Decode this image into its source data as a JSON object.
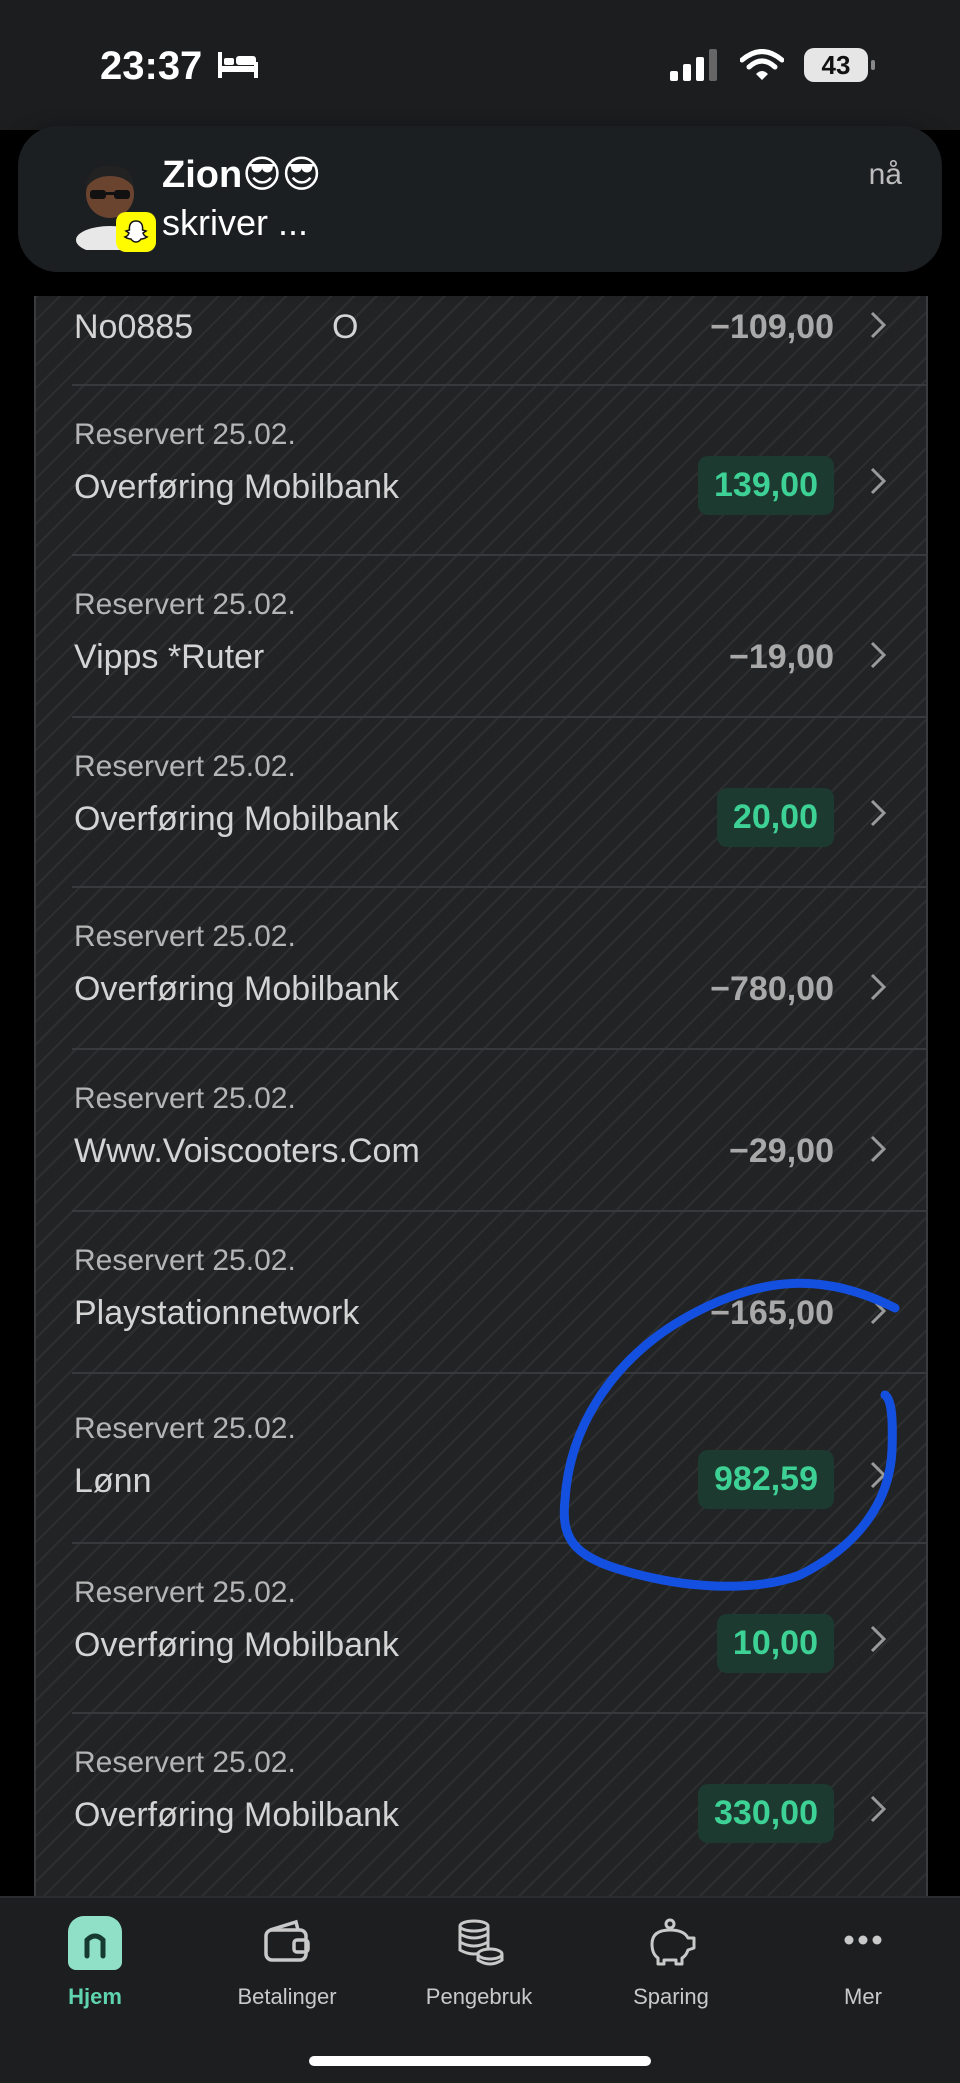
{
  "status_bar": {
    "time": "23:37",
    "battery": "43"
  },
  "notification": {
    "title": "Zion😎😎",
    "body": "skriver ...",
    "time": "nå"
  },
  "transactions": [
    {
      "date": "",
      "description": "No0885",
      "extra": "O",
      "amount": "−109,00",
      "positive": false
    },
    {
      "date": "Reservert 25.02.",
      "description": "Overføring Mobilbank",
      "amount": "139,00",
      "positive": true
    },
    {
      "date": "Reservert 25.02.",
      "description": "Vipps *Ruter",
      "amount": "−19,00",
      "positive": false
    },
    {
      "date": "Reservert 25.02.",
      "description": "Overføring Mobilbank",
      "amount": "20,00",
      "positive": true
    },
    {
      "date": "Reservert 25.02.",
      "description": "Overføring Mobilbank",
      "amount": "−780,00",
      "positive": false
    },
    {
      "date": "Reservert 25.02.",
      "description": "Www.Voiscooters.Com",
      "amount": "−29,00",
      "positive": false
    },
    {
      "date": "Reservert 25.02.",
      "description": "Playstationnetwork",
      "amount": "−165,00",
      "positive": false
    },
    {
      "date": "Reservert 25.02.",
      "description": "Lønn",
      "amount": "982,59",
      "positive": true
    },
    {
      "date": "Reservert 25.02.",
      "description": "Overføring Mobilbank",
      "amount": "10,00",
      "positive": true
    },
    {
      "date": "Reservert 25.02.",
      "description": "Overføring Mobilbank",
      "amount": "330,00",
      "positive": true
    }
  ],
  "tabs": [
    {
      "label": "Hjem",
      "icon": "home-icon",
      "active": true
    },
    {
      "label": "Betalinger",
      "icon": "wallet-icon",
      "active": false
    },
    {
      "label": "Pengebruk",
      "icon": "coins-icon",
      "active": false
    },
    {
      "label": "Sparing",
      "icon": "piggy-bank-icon",
      "active": false
    },
    {
      "label": "Mer",
      "icon": "more-icon",
      "active": false
    }
  ],
  "colors": {
    "positive_amount": "#3ed195",
    "positive_bg": "#1c3a30",
    "active_tab": "#5fd3ad",
    "annotation": "#1450e0"
  }
}
